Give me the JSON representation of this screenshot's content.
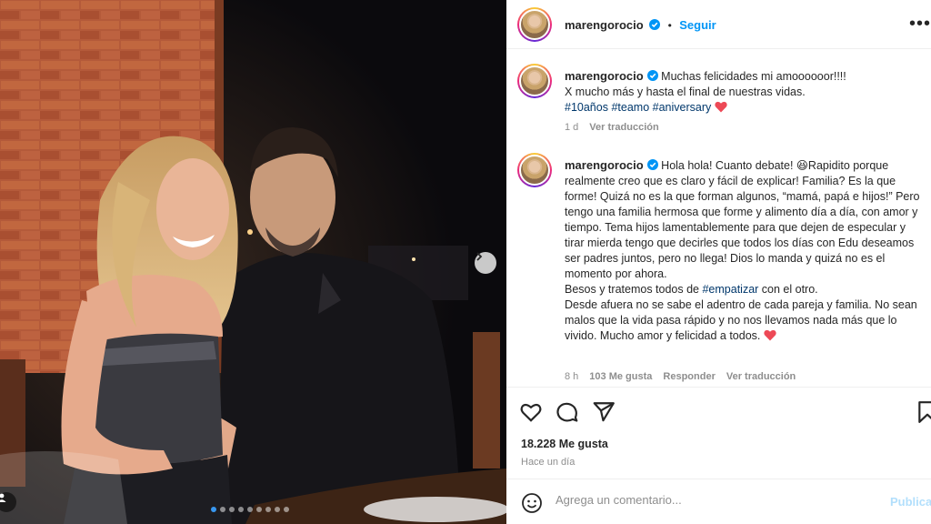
{
  "post": {
    "username": "marengorocio",
    "verified": true,
    "follow_label": "Seguir",
    "bullet": "•",
    "more_label": "•••"
  },
  "caption": {
    "username": "marengorocio",
    "text_line1": "Muchas felicidades mi amoooooor!!!!",
    "text_line2": "X mucho más y hasta el final de nuestras vidas.",
    "hashtags": [
      "#10años",
      "#teamo",
      "#aniversary"
    ],
    "time": "1 d",
    "translate_label": "Ver traducción"
  },
  "comment": {
    "username": "marengorocio",
    "text_part1": "Hola hola! Cuanto debate! 😆Rapidito porque realmente creo que es claro y fácil de explicar! Familia? Es la que forme! Quizá no es la que forman algunos, “mamá, papá e hijos!” Pero tengo una familia hermosa que forme y alimento día a día, con amor y tiempo. Tema hijos lamentablemente para que dejen de especular y tirar mierda tengo que decirles que todos los días con Edu deseamos ser padres juntos, pero no llega! Dios lo manda y quizá no es el momento por ahora.",
    "text_part2_before": "Besos y tratemos todos de ",
    "text_part2_tag": "#empatizar",
    "text_part2_after": " con el otro.",
    "text_part3": "Desde afuera no se sabe el adentro de cada pareja y familia. No sean malos que la vida pasa rápido y no nos llevamos nada más que lo vivido. Mucho amor y felicidad a todos.",
    "time": "8 h",
    "likes": "103 Me gusta",
    "reply_label": "Responder",
    "translate_label": "Ver traducción"
  },
  "actions": {
    "icons": [
      "heart-icon",
      "comment-icon",
      "share-icon",
      "bookmark-icon"
    ],
    "likes_count": "18.228 Me gusta",
    "date": "Hace un día"
  },
  "add_comment": {
    "placeholder": "Agrega un comentario...",
    "publish_label": "Publicar"
  },
  "carousel": {
    "total_slides": 9,
    "current_slide": 1
  },
  "colors": {
    "accent": "#0095f6",
    "heart_red": "#ed4956",
    "hashtag": "#00376b",
    "muted": "#8e8e8e"
  }
}
